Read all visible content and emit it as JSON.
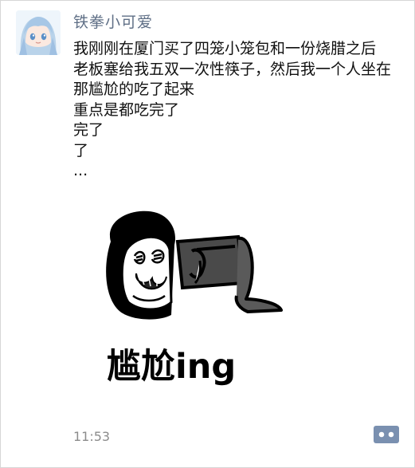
{
  "post": {
    "username": "铁拳小可爱",
    "text_lines": [
      "我刚刚在厦门买了四笼小笼包和一份烧腊之后",
      "老板塞给我五双一次性筷子，然后我一个人坐在",
      "那尴尬的吃了起来",
      "重点是都吃完了",
      "完了",
      "了",
      "..."
    ],
    "sticker_caption": "尴尬ing",
    "time": "11:53"
  },
  "icons": {
    "avatar": "anime-girl-avatar",
    "comment": "comment-dots-icon"
  },
  "colors": {
    "username": "#5f6f86",
    "text": "#111111",
    "time": "#8c8c8c",
    "comment_button": "#7a90b0"
  }
}
